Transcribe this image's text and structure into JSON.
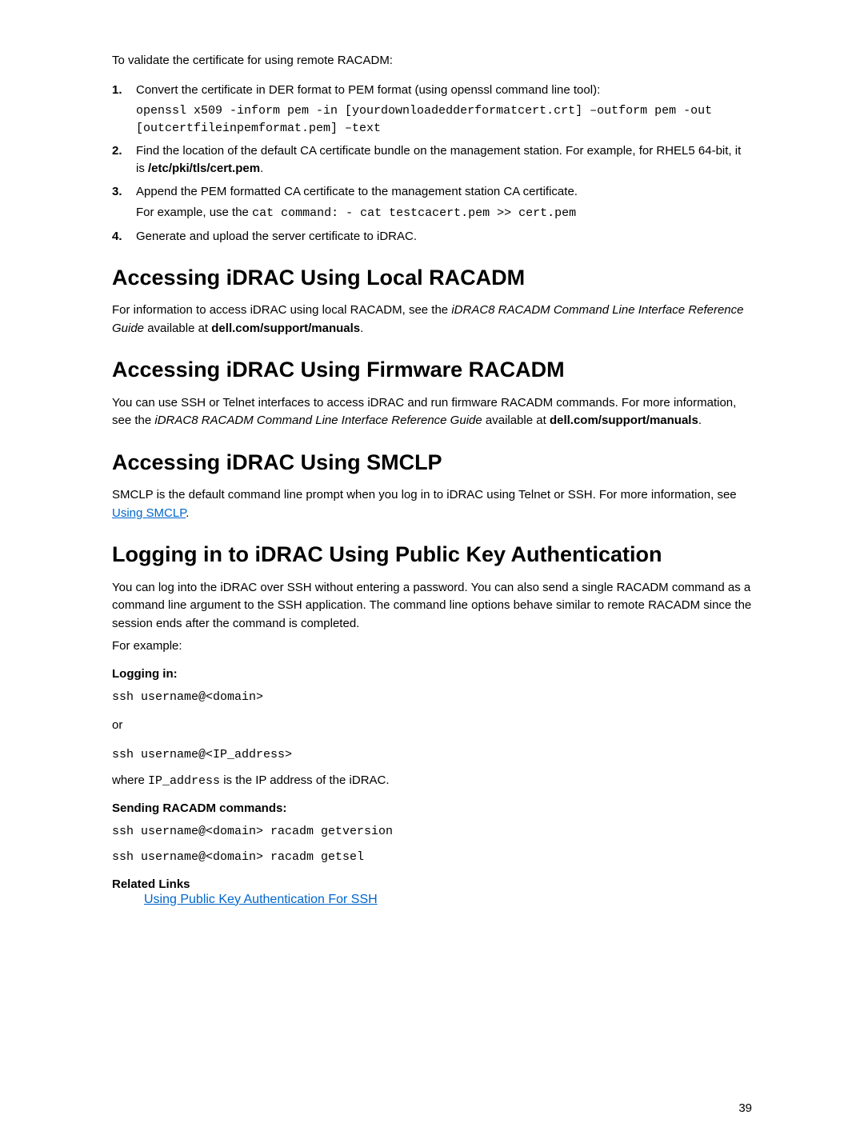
{
  "intro_text": "To validate the certificate for using remote RACADM:",
  "steps": [
    {
      "num": "1.",
      "text": "Convert the certificate in DER format to PEM format (using openssl command line tool):",
      "code": "openssl x509 -inform pem -in [yourdownloadedderformatcert.crt] –outform pem -out [outcertfileinpemformat.pem] –text"
    },
    {
      "num": "2.",
      "text_prefix": "Find the location of the default CA certificate bundle on the management station. For example, for RHEL5 64-bit, it is ",
      "text_bold": "/etc/pki/tls/cert.pem",
      "text_suffix": "."
    },
    {
      "num": "3.",
      "text": "Append the PEM formatted CA certificate to the management station CA certificate.",
      "example_prefix": "For example, use the ",
      "example_code": "cat command: - cat testcacert.pem >> cert.pem"
    },
    {
      "num": "4.",
      "text": "Generate and upload the server certificate to iDRAC."
    }
  ],
  "sections": {
    "local_racadm": {
      "heading": "Accessing iDRAC Using Local RACADM",
      "para_prefix": "For information to access iDRAC using local RACADM, see the ",
      "para_italic": "iDRAC8 RACADM Command Line Interface Reference Guide",
      "para_mid": " available at ",
      "para_bold": "dell.com/support/manuals",
      "para_suffix": "."
    },
    "firmware_racadm": {
      "heading": "Accessing iDRAC Using Firmware RACADM",
      "para_prefix": "You can use SSH or Telnet interfaces to access iDRAC and run firmware RACADM commands. For more information, see the ",
      "para_italic": "iDRAC8 RACADM Command Line Interface Reference Guide",
      "para_mid": " available at ",
      "para_bold": "dell.com/support/manuals",
      "para_suffix": "."
    },
    "smclp": {
      "heading": "Accessing iDRAC Using SMCLP",
      "para_prefix": "SMCLP is the default command line prompt when you log in to iDRAC using Telnet or SSH. For more information, see ",
      "para_link": "Using SMCLP",
      "para_suffix": "."
    },
    "pka": {
      "heading": "Logging in to iDRAC Using Public Key Authentication",
      "para1": "You can log into the iDRAC over SSH without entering a password. You can also send a single RACADM command as a command line argument to the SSH application. The command line options behave similar to remote RACADM since the session ends after the command is completed.",
      "para2": "For example:",
      "logging_in_label": "Logging in:",
      "cmd1": "ssh username@<domain>",
      "or_text": "or",
      "cmd2": "ssh username@<IP_address>",
      "where_prefix": "where ",
      "where_code": "IP_address",
      "where_suffix": " is the IP address of the iDRAC.",
      "sending_label": "Sending RACADM commands:",
      "cmd3": "ssh username@<domain> racadm getversion",
      "cmd4": "ssh username@<domain> racadm getsel",
      "related_label": "Related Links",
      "related_link": "Using Public Key Authentication For SSH"
    }
  },
  "page_number": "39"
}
